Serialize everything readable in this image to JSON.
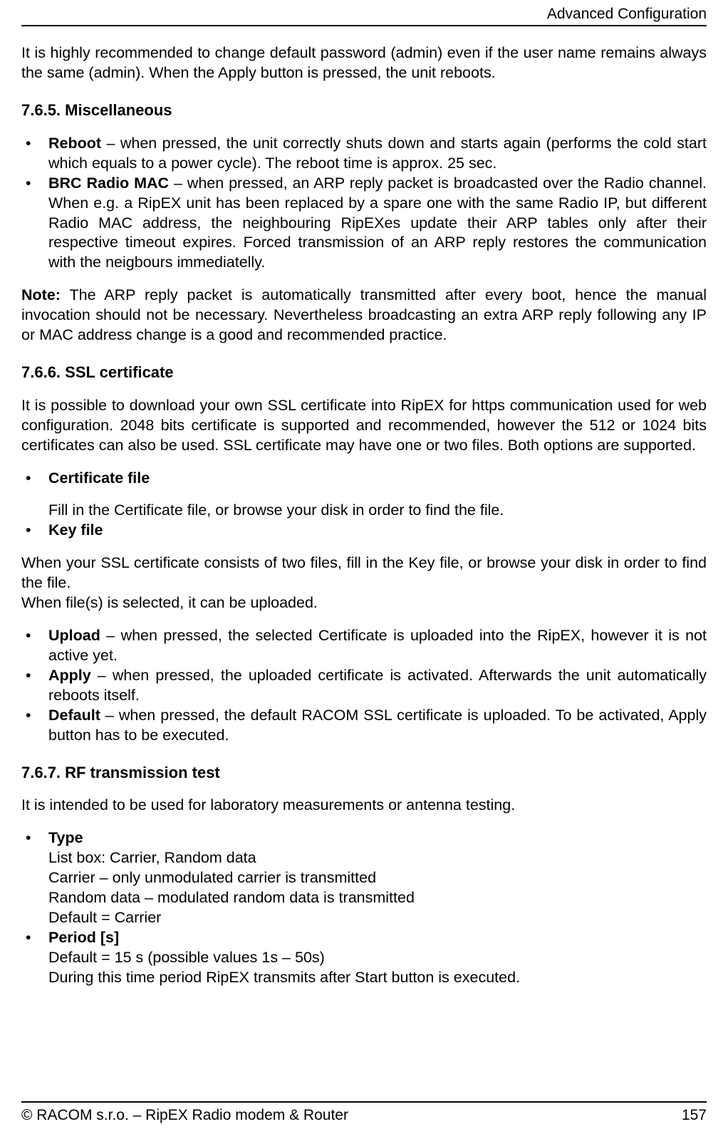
{
  "header": {
    "section": "Advanced Configuration"
  },
  "intro_para": "It is highly recommended to change default password (admin) even if the user name remains always the same (admin). When the Apply button is pressed, the unit reboots.",
  "sec_765": {
    "heading": "7.6.5. Miscellaneous",
    "reboot_label": "Reboot",
    "reboot_text": " – when pressed, the unit correctly shuts down and starts again (performs the cold start which equals to a power cycle). The reboot time is approx. 25 sec.",
    "brc_label": "BRC Radio MAC",
    "brc_text": " – when pressed, an ARP reply packet is broadcasted over the Radio channel. When e.g. a RipEX unit has been replaced by a spare one with the same Radio IP, but different Radio MAC address, the neighbouring RipEXes update their ARP tables only after their respective timeout expires. Forced transmission of an ARP reply restores the communication with the neigbours immediatelly.",
    "note_label": "Note:",
    "note_text": " The ARP reply packet is automatically transmitted after every boot, hence the manual invocation should not be necessary. Nevertheless broadcasting an extra ARP reply following any IP or MAC address change is a good and recommended practice."
  },
  "sec_766": {
    "heading": "7.6.6. SSL certificate",
    "intro": "It is possible to download your own SSL certificate into RipEX for https communication used for web configuration. 2048 bits certificate is supported and recommended, however the 512 or 1024 bits certificates can also be used. SSL certificate may have one or two files. Both options are supported.",
    "cert_label": "Certificate file",
    "cert_desc": "Fill in the Certificate file, or browse your disk in order to find the file.",
    "key_label": "Key file",
    "key_para": "When your SSL certificate consists of two files, fill in the Key file, or browse your disk in order to find the file.",
    "key_para2": "When file(s) is selected, it can be uploaded.",
    "upload_label": "Upload",
    "upload_text": " – when pressed, the selected Certificate is uploaded into the RipEX, however it is not active yet.",
    "apply_label": "Apply",
    "apply_text": "  – when pressed, the uploaded certificate is activated. Afterwards the unit automatically reboots itself.",
    "default_label": "Default",
    "default_text": "  – when pressed, the default RACOM SSL certificate is uploaded. To be activated, Apply button has to be executed."
  },
  "sec_767": {
    "heading": "7.6.7. RF transmission test",
    "intro": "It is intended to be used for laboratory measurements or antenna testing.",
    "type_label": "Type",
    "type_line1": "List box: Carrier, Random data",
    "type_line2": "Carrier – only unmodulated carrier is transmitted",
    "type_line3": "Random data – modulated random data is transmitted",
    "type_line4": "Default = Carrier",
    "period_label": "Period [s]",
    "period_line1": "Default = 15 s (possible values 1s – 50s)",
    "period_line2": "During this time period RipEX transmits after Start button is executed."
  },
  "footer": {
    "copyright": "© RACOM s.r.o. – RipEX Radio modem & Router",
    "page": "157"
  }
}
